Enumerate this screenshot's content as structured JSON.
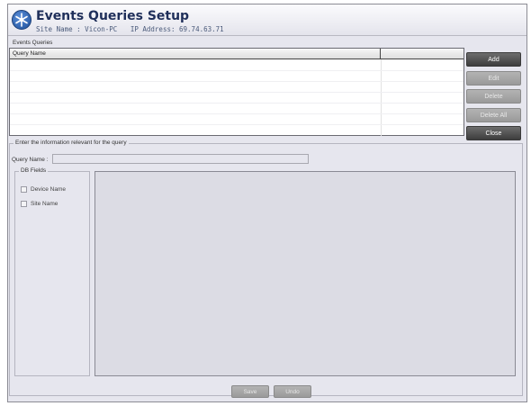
{
  "header": {
    "title": "Events Queries Setup",
    "site_name": "Site Name : Vicon-PC",
    "ip_address": "IP Address: 69.74.63.71",
    "logo_icon": "snowflake-gear-icon"
  },
  "events_queries": {
    "label": "Events Queries",
    "columns": [
      "Query Name",
      ""
    ],
    "rows": []
  },
  "buttons": {
    "add": "Add",
    "edit": "Edit",
    "delete": "Delete",
    "delete_all": "Delete All",
    "close": "Close",
    "save": "Save",
    "undo": "Undo"
  },
  "query_info": {
    "legend": "Enter the information relevant for the query",
    "query_name_label": "Query Name :",
    "query_name_value": ""
  },
  "db_fields": {
    "legend": "DB Fields",
    "items": [
      {
        "label": "Device Name",
        "checked": false
      },
      {
        "label": "Site Name",
        "checked": false
      }
    ]
  },
  "colors": {
    "window_bg": "#e6e6ee",
    "title": "#1f2f5a",
    "button_active": "#4f4f4f",
    "button_disabled": "#a8a8a8"
  }
}
